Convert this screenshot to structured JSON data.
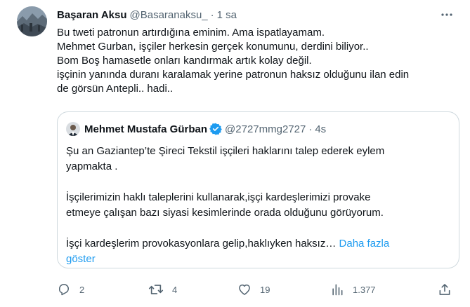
{
  "tweet": {
    "author_name": "Başaran Aksu",
    "author_handle": "@Basaranaksu_",
    "separator": "·",
    "time": "1 sa",
    "lines": [
      "Bu tweti patronun artırdığına eminim.  Ama ispatlayamam.",
      "Mehmet Gurban, işçiler herkesin gerçek konumunu, derdini biliyor..",
      "Bom Boş hamasetle onları kandırmak artık kolay değil.",
      "işçinin yanında duranı karalamak yerine patronun haksız olduğunu ilan edin",
      "de görsün Antepli.. hadi.."
    ]
  },
  "quote": {
    "author_name": "Mehmet Mustafa Gürban",
    "author_handle": "@2727mmg2727",
    "separator": "·",
    "time": "4s",
    "lines": [
      "Şu an Gaziantep’te Şireci Tekstil işçileri haklarını talep ederek eylem",
      "yapmakta .",
      "İşçilerimizin haklı taleplerini kullanarak,işçi kardeşlerimizi provake",
      "etmeye çalışan bazı siyasi kesimlerinde orada olduğunu görüyorum.",
      "İşçi kardeşlerim provokasyonlara gelip,haklıyken haksız…"
    ],
    "show_more_part1": "Daha fazla",
    "show_more_part2": "göster"
  },
  "actions": {
    "replies": "2",
    "retweets": "4",
    "likes": "19",
    "views": "1.377"
  },
  "icons": {
    "more": "more-dots-icon",
    "reply": "reply-icon",
    "retweet": "retweet-icon",
    "like": "like-icon",
    "views": "views-icon",
    "share": "share-icon",
    "verified": "verified-badge-icon"
  },
  "colors": {
    "text": "#0f1419",
    "secondary": "#536471",
    "link": "#1d9bf0",
    "border": "#cfd9de"
  }
}
